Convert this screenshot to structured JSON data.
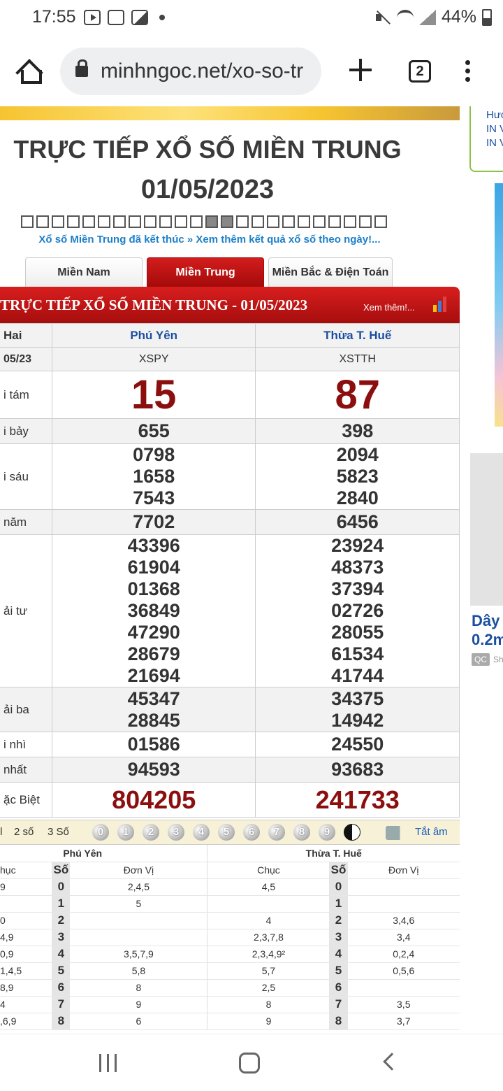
{
  "status_bar": {
    "time": "17:55",
    "battery": "44%"
  },
  "browser": {
    "url": "minhngoc.net/xo-so-tr",
    "tab_count": "2"
  },
  "page": {
    "title": "TRỰC TIẾP XỔ SỐ MIỀN TRUNG",
    "date": "01/05/2023",
    "notice": "Xổ số Miền Trung đã kết thúc » Xem thêm kết quả xổ số theo ngày!...",
    "tabs": [
      "Miền Nam",
      "Miền Trung",
      "Miền Bắc & Điện Toán"
    ],
    "section_title": "TRỰC TIẾP XỔ SỐ MIỀN TRUNG - 01/05/2023",
    "see_more": "Xem thêm!..."
  },
  "results": {
    "header_day": "Hai",
    "header_date": "05/23",
    "provinces": [
      {
        "name": "Phú Yên",
        "code": "XSPY"
      },
      {
        "name": "Thừa T. Huế",
        "code": "XSTTH"
      }
    ],
    "prizes": [
      {
        "label": "i tám",
        "values": [
          [
            "15"
          ],
          [
            "87"
          ]
        ]
      },
      {
        "label": "i bảy",
        "values": [
          [
            "655"
          ],
          [
            "398"
          ]
        ]
      },
      {
        "label": "i sáu",
        "values": [
          [
            "0798",
            "1658",
            "7543"
          ],
          [
            "2094",
            "5823",
            "2840"
          ]
        ]
      },
      {
        "label": " năm",
        "values": [
          [
            "7702"
          ],
          [
            "6456"
          ]
        ]
      },
      {
        "label": "ải tư",
        "values": [
          [
            "43396",
            "61904",
            "01368",
            "36849",
            "47290",
            "28679",
            "21694"
          ],
          [
            "23924",
            "48373",
            "37394",
            "02726",
            "28055",
            "61534",
            "41744"
          ]
        ]
      },
      {
        "label": "ải ba",
        "values": [
          [
            "45347",
            "28845"
          ],
          [
            "34375",
            "14942"
          ]
        ]
      },
      {
        "label": "i nhì",
        "values": [
          [
            "01586"
          ],
          [
            "24550"
          ]
        ]
      },
      {
        "label": " nhất",
        "values": [
          [
            "94593"
          ],
          [
            "93683"
          ]
        ]
      },
      {
        "label": "ặc Biệt",
        "values": [
          [
            "804205"
          ],
          [
            "241733"
          ]
        ]
      }
    ]
  },
  "options": {
    "digits": [
      "l",
      "2 số",
      "3 Số"
    ],
    "balls": [
      "0",
      "1",
      "2",
      "3",
      "4",
      "5",
      "6",
      "7",
      "8",
      "9"
    ],
    "mute_label": "Tắt âm"
  },
  "loto": {
    "provinces": [
      "Phú Yên",
      "Thừa T. Huế"
    ],
    "headers": [
      "hục",
      "Số",
      "Đơn Vị",
      "Chục",
      "Số",
      "Đơn Vị"
    ],
    "rows": [
      [
        "9",
        "0",
        "2,4,5",
        "4,5",
        "0",
        ""
      ],
      [
        "",
        "1",
        "5",
        "",
        "1",
        ""
      ],
      [
        "0",
        "2",
        "",
        "4",
        "2",
        "3,4,6"
      ],
      [
        "4,9",
        "3",
        "",
        "2,3,7,8",
        "3",
        "3,4"
      ],
      [
        "0,9",
        "4",
        "3,5,7,9",
        "2,3,4,9²",
        "4",
        "0,2,4"
      ],
      [
        "1,4,5",
        "5",
        "5,8",
        "5,7",
        "5",
        "0,5,6"
      ],
      [
        "8,9",
        "6",
        "8",
        "2,5",
        "6",
        ""
      ],
      [
        "4",
        "7",
        "9",
        "8",
        "7",
        "3,5"
      ],
      [
        ",6,9",
        "8",
        "6",
        "9",
        "8",
        "3,7"
      ]
    ]
  },
  "sidebar": {
    "links": [
      "Hướ",
      "IN V",
      "IN V"
    ],
    "ad_text": [
      "Dây",
      "0.2m"
    ],
    "qc": "QC",
    "qc_sh": "Sh"
  },
  "colors": {
    "accent_red": "#a40a0a",
    "prize_red": "#8b0f0f",
    "link_blue": "#1a4fa0",
    "notice_blue": "#1c7fc9"
  }
}
